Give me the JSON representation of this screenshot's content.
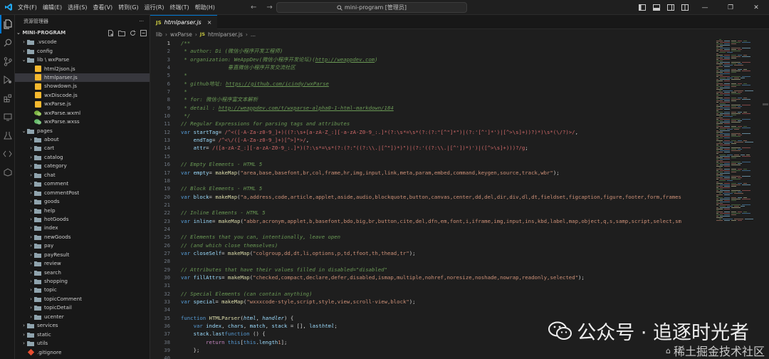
{
  "titlebar": {
    "menu": [
      "文件(F)",
      "编辑(E)",
      "选择(S)",
      "查看(V)",
      "转到(G)",
      "运行(R)",
      "终端(T)",
      "帮助(H)"
    ],
    "search_text": "mini-program [管理员]",
    "nav_back": "←",
    "nav_forward": "→"
  },
  "sidebar": {
    "header": "资源管理器",
    "more": "···",
    "section_title": "MINI-PROGRAM",
    "tree": [
      {
        "label": ".vscode",
        "type": "folder",
        "depth": 1,
        "open": false
      },
      {
        "label": "config",
        "type": "folder",
        "depth": 1,
        "open": false
      },
      {
        "label": "lib \\ wxParse",
        "type": "folder",
        "depth": 1,
        "open": true
      },
      {
        "label": "html2json.js",
        "type": "js",
        "depth": 2
      },
      {
        "label": "htmlparser.js",
        "type": "js",
        "depth": 2,
        "selected": true
      },
      {
        "label": "showdown.js",
        "type": "js",
        "depth": 2
      },
      {
        "label": "wxDiscode.js",
        "type": "js",
        "depth": 2
      },
      {
        "label": "wxParse.js",
        "type": "js",
        "depth": 2
      },
      {
        "label": "wxParse.wxml",
        "type": "wxml",
        "depth": 2
      },
      {
        "label": "wxParse.wxss",
        "type": "wxss",
        "depth": 2
      },
      {
        "label": "pages",
        "type": "folder",
        "depth": 1,
        "open": true
      },
      {
        "label": "about",
        "type": "folder",
        "depth": 2,
        "open": false
      },
      {
        "label": "cart",
        "type": "folder",
        "depth": 2,
        "open": false
      },
      {
        "label": "catalog",
        "type": "folder",
        "depth": 2,
        "open": false
      },
      {
        "label": "category",
        "type": "folder",
        "depth": 2,
        "open": false
      },
      {
        "label": "chat",
        "type": "folder",
        "depth": 2,
        "open": false
      },
      {
        "label": "comment",
        "type": "folder",
        "depth": 2,
        "open": false
      },
      {
        "label": "commentPost",
        "type": "folder",
        "depth": 2,
        "open": false
      },
      {
        "label": "goods",
        "type": "folder",
        "depth": 2,
        "open": false
      },
      {
        "label": "help",
        "type": "folder",
        "depth": 2,
        "open": false
      },
      {
        "label": "hotGoods",
        "type": "folder",
        "depth": 2,
        "open": false
      },
      {
        "label": "index",
        "type": "folder",
        "depth": 2,
        "open": false
      },
      {
        "label": "newGoods",
        "type": "folder",
        "depth": 2,
        "open": false
      },
      {
        "label": "pay",
        "type": "folder",
        "depth": 2,
        "open": false
      },
      {
        "label": "payResult",
        "type": "folder",
        "depth": 2,
        "open": false
      },
      {
        "label": "review",
        "type": "folder",
        "depth": 2,
        "open": false
      },
      {
        "label": "search",
        "type": "folder",
        "depth": 2,
        "open": false
      },
      {
        "label": "shopping",
        "type": "folder",
        "depth": 2,
        "open": false
      },
      {
        "label": "topic",
        "type": "folder",
        "depth": 2,
        "open": false
      },
      {
        "label": "topicComment",
        "type": "folder",
        "depth": 2,
        "open": false
      },
      {
        "label": "topicDetail",
        "type": "folder",
        "depth": 2,
        "open": false
      },
      {
        "label": "ucenter",
        "type": "folder",
        "depth": 2,
        "open": false
      },
      {
        "label": "services",
        "type": "folder",
        "depth": 1,
        "open": false
      },
      {
        "label": "static",
        "type": "folder",
        "depth": 1,
        "open": false
      },
      {
        "label": "utils",
        "type": "folder",
        "depth": 1,
        "open": false
      },
      {
        "label": ".gitignore",
        "type": "git",
        "depth": 1
      }
    ]
  },
  "editor": {
    "tab_label": "htmlparser.js",
    "tab_close": "×",
    "breadcrumb": [
      "lib",
      "wxParse",
      "htmlparser.js",
      "..."
    ],
    "current_line": 1,
    "lines": [
      [
        [
          "c",
          "/**"
        ]
      ],
      [
        [
          "c",
          " * author: Di (微信小程序开发工程师)"
        ]
      ],
      [
        [
          "c",
          " * organization: WeAppDev(微信小程序开发论坛)("
        ],
        [
          "lnk",
          "http://weappdev.com"
        ],
        [
          "c",
          ")"
        ]
      ],
      [
        [
          "c",
          "               垂直微信小程序开发交流社区"
        ]
      ],
      [
        [
          "c",
          " *"
        ]
      ],
      [
        [
          "c",
          " * github地址: "
        ],
        [
          "lnk",
          "https://github.com/icindy/wxParse"
        ]
      ],
      [
        [
          "c",
          " *"
        ]
      ],
      [
        [
          "c",
          " * for: 微信小程序富文本解析"
        ]
      ],
      [
        [
          "c",
          " * detail : "
        ],
        [
          "lnk",
          "http://weappdev.com/t/wxparse-alpha0-1-html-markdown/184"
        ]
      ],
      [
        [
          "c",
          " */"
        ]
      ],
      [
        [
          "c",
          "// Regular Expressions for parsing tags and attributes"
        ]
      ],
      [
        [
          "k",
          "var "
        ],
        [
          "v",
          "startTag"
        ],
        [
          "",
          "= "
        ],
        [
          "r",
          "/^<([-A-Za-z0-9_]+)((?:\\s+[a-zA-Z_:][-a-zA-Z0-9_:.]*(?:\\s*=\\s*(?:(?:\"[^\"]*\")|(?:'[^']*')|[^>\\s]+))?)*)\\s*(\\/?)>/"
        ],
        [
          "",
          ","
        ]
      ],
      [
        [
          "",
          "    "
        ],
        [
          "v",
          "endTag"
        ],
        [
          "",
          "= "
        ],
        [
          "r",
          "/^<\\/([-A-Za-z0-9_]+)[^>]*>/"
        ],
        [
          "",
          ","
        ]
      ],
      [
        [
          "",
          "    "
        ],
        [
          "v",
          "attr"
        ],
        [
          "",
          "= "
        ],
        [
          "r",
          "/([a-zA-Z_:][-a-zA-Z0-9_:.]*)(?:\\s*=\\s*(?:(?:\"((?:\\\\.|[^\"])*)\")|(?:'((?:\\\\.|[^'])*)')|([^>\\s]+)))?/g"
        ],
        [
          "",
          ";"
        ]
      ],
      [
        [
          "",
          ""
        ]
      ],
      [
        [
          "c",
          "// Empty Elements - HTML 5"
        ]
      ],
      [
        [
          "k",
          "var "
        ],
        [
          "v",
          "empty"
        ],
        [
          "",
          "= "
        ],
        [
          "f",
          "makeMap"
        ],
        [
          "",
          "("
        ],
        [
          "s",
          "\"area,base,basefont,br,col,frame,hr,img,input,link,meta,param,embed,command,keygen,source,track,wbr\""
        ],
        [
          "",
          ");"
        ]
      ],
      [
        [
          "",
          ""
        ]
      ],
      [
        [
          "c",
          "// Block Elements - HTML 5"
        ]
      ],
      [
        [
          "k",
          "var "
        ],
        [
          "v",
          "block"
        ],
        [
          "",
          "= "
        ],
        [
          "f",
          "makeMap"
        ],
        [
          "",
          "("
        ],
        [
          "s",
          "\"a,address,code,article,applet,aside,audio,blockquote,button,canvas,center,dd,del,dir,div,dl,dt,fieldset,figcaption,figure,footer,form,frames"
        ]
      ],
      [
        [
          "",
          ""
        ]
      ],
      [
        [
          "c",
          "// Inline Elements - HTML 5"
        ]
      ],
      [
        [
          "k",
          "var "
        ],
        [
          "v",
          "inline"
        ],
        [
          "",
          "= "
        ],
        [
          "f",
          "makeMap"
        ],
        [
          "",
          "("
        ],
        [
          "s",
          "\"abbr,acronym,applet,b,basefont,bdo,big,br,button,cite,del,dfn,em,font,i,iframe,img,input,ins,kbd,label,map,object,q,s,samp,script,select,sm"
        ]
      ],
      [
        [
          "",
          ""
        ]
      ],
      [
        [
          "c",
          "// Elements that you can, intentionally, leave open"
        ]
      ],
      [
        [
          "c",
          "// (and which close themselves)"
        ]
      ],
      [
        [
          "k",
          "var "
        ],
        [
          "v",
          "closeSelf"
        ],
        [
          "",
          "= "
        ],
        [
          "f",
          "makeMap"
        ],
        [
          "",
          "("
        ],
        [
          "s",
          "\"colgroup,dd,dt,li,options,p,td,tfoot,th,thead,tr\""
        ],
        [
          "",
          ");"
        ]
      ],
      [
        [
          "",
          ""
        ]
      ],
      [
        [
          "c",
          "// Attributes that have their values filled in disabled=\"disabled\""
        ]
      ],
      [
        [
          "k",
          "var "
        ],
        [
          "v",
          "fillAttrs"
        ],
        [
          "",
          "= "
        ],
        [
          "f",
          "makeMap"
        ],
        [
          "",
          "("
        ],
        [
          "s",
          "\"checked,compact,declare,defer,disabled,ismap,multiple,nohref,noresize,noshade,nowrap,readonly,selected\""
        ],
        [
          "",
          ");"
        ]
      ],
      [
        [
          "",
          ""
        ]
      ],
      [
        [
          "c",
          "// Special Elements (can contain anything)"
        ]
      ],
      [
        [
          "k",
          "var "
        ],
        [
          "v",
          "special"
        ],
        [
          "",
          "= "
        ],
        [
          "f",
          "makeMap"
        ],
        [
          "",
          "("
        ],
        [
          "s",
          "\"wxxxcode-style,script,style,view,scroll-view,block\""
        ],
        [
          "",
          ");"
        ]
      ],
      [
        [
          "",
          ""
        ]
      ],
      [
        [
          "k",
          "function "
        ],
        [
          "f",
          "HTMLParser"
        ],
        [
          "",
          "("
        ],
        [
          "p",
          "html"
        ],
        [
          "",
          ", "
        ],
        [
          "p",
          "handler"
        ],
        [
          "",
          ") {"
        ]
      ],
      [
        [
          "",
          "    "
        ],
        [
          "k",
          "var "
        ],
        [
          "v",
          "index"
        ],
        [
          "",
          ", "
        ],
        [
          "v",
          "chars"
        ],
        [
          "",
          ", "
        ],
        [
          "v",
          "match"
        ],
        [
          "",
          ", "
        ],
        [
          "v",
          "stack"
        ],
        [
          "",
          " = [], "
        ],
        [
          "v",
          "last"
        ],
        [
          "",
          "",
          " = "
        ],
        [
          "p",
          "html"
        ],
        [
          "",
          ";"
        ]
      ],
      [
        [
          "",
          "    "
        ],
        [
          "v",
          "stack"
        ],
        [
          "",
          "."
        ],
        [
          "v",
          "last"
        ],
        [
          "",
          "",
          " = "
        ],
        [
          "k",
          "function "
        ],
        [
          "",
          "() {"
        ]
      ],
      [
        [
          "",
          "        "
        ],
        [
          "kc",
          "return "
        ],
        [
          "k",
          "this"
        ],
        [
          "",
          "["
        ],
        [
          "k",
          "this"
        ],
        [
          "",
          "."
        ],
        [
          "v",
          "length"
        ],
        [
          "",
          "",
          " - "
        ],
        [
          "s",
          "1"
        ],
        [
          "",
          "];"
        ]
      ],
      [
        [
          "",
          "    };"
        ]
      ],
      [
        [
          "",
          ""
        ]
      ]
    ]
  },
  "watermark": {
    "main": "公众号 · 追逐时光者",
    "sub": "稀土掘金技术社区"
  }
}
